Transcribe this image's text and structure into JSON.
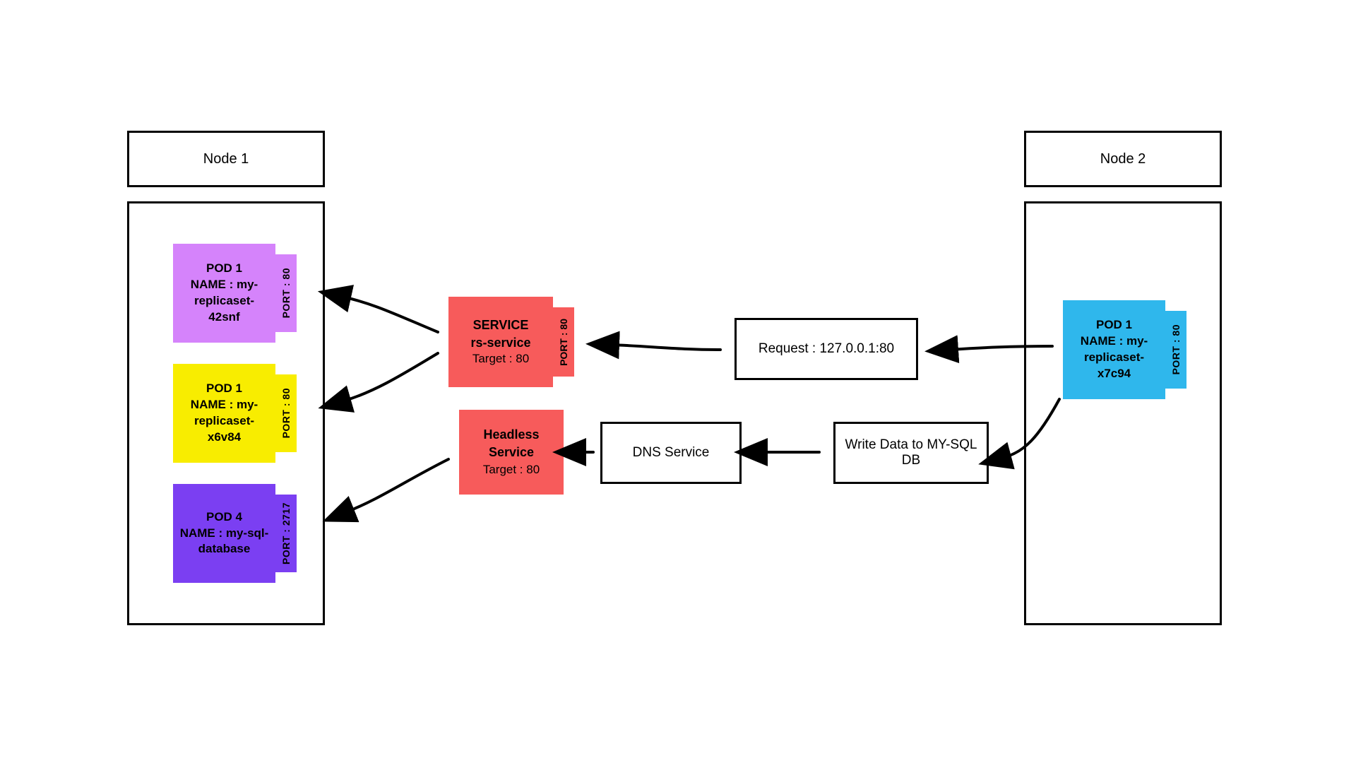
{
  "node1": {
    "title": "Node 1",
    "pods": [
      {
        "header": "POD 1",
        "name_label": "NAME : my-replicaset-42snf",
        "port": "PORT : 80",
        "color": "#d583fb"
      },
      {
        "header": "POD 1",
        "name_label": "NAME : my-replicaset-x6v84",
        "port": "PORT : 80",
        "color": "#f8ed00"
      },
      {
        "header": "POD 4",
        "name_label": "NAME : my-sql-database",
        "port": "PORT : 2717",
        "color": "#7b3ff2"
      }
    ]
  },
  "node2": {
    "title": "Node 2",
    "pod": {
      "header": "POD 1",
      "name_label": "NAME : my-replicaset-x7c94",
      "port": "PORT : 80",
      "color": "#2fb7ec"
    }
  },
  "service": {
    "title": "SERVICE",
    "name": "rs-service",
    "target": "Target : 80",
    "port": "PORT : 80"
  },
  "headless": {
    "title": "Headless Service",
    "target": "Target : 80"
  },
  "request_box": "Request : 127.0.0.1:80",
  "dns_box": "DNS Service",
  "write_box": "Write Data to MY-SQL DB",
  "colors": {
    "service": "#f75b5b"
  }
}
